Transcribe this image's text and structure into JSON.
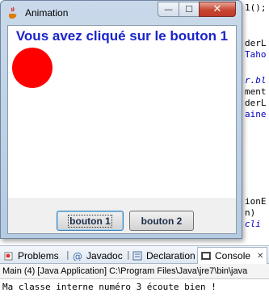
{
  "window": {
    "title": "Animation",
    "controls": {
      "minimize": "—",
      "maximize": "☐",
      "close": "✕"
    },
    "message": "Vous avez cliqué sur le bouton 1",
    "ball_color": "#ff0000",
    "buttons": {
      "b1": "bouton 1",
      "b2": "bouton 2"
    }
  },
  "ide": {
    "code_fragments": [
      "1();",
      "derL",
      "Taho",
      "r.bl",
      "ment",
      "derL",
      "aine",
      "ionE",
      "n)",
      "cli"
    ]
  },
  "bottom_panel": {
    "tabs": [
      "Problems",
      "Javadoc",
      "Declaration",
      "Console"
    ],
    "close_glyph": "✕",
    "launch_info": "Main (4) [Java Application] C:\\Program Files\\Java\\jre7\\bin\\java",
    "output": "Ma classe interne numéro 3 écoute bien !"
  },
  "colors": {
    "accent": "#1a24c9",
    "ball": "#ff0000"
  }
}
